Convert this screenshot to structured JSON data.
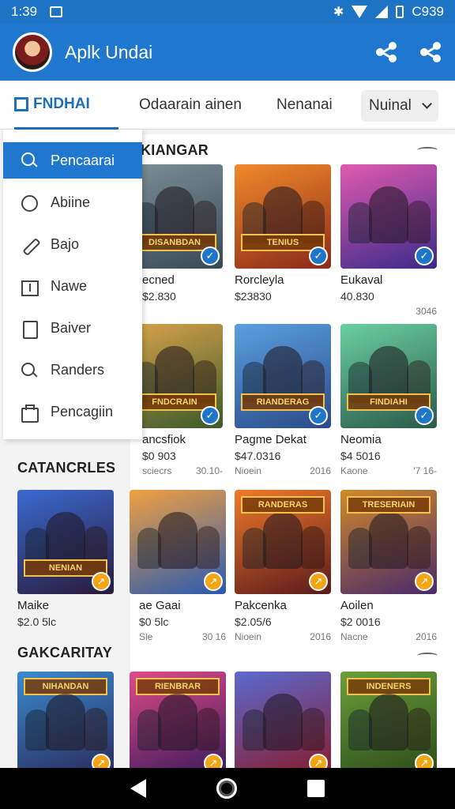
{
  "status_bar": {
    "time": "1:39",
    "battery": "C939"
  },
  "app_bar": {
    "title": "Aplk Undai",
    "share_icon": "share-icon"
  },
  "tabs": [
    {
      "label": "FNDHAI",
      "active": true
    },
    {
      "label": "Odaarain ainen",
      "active": false
    },
    {
      "label": "Nenanai",
      "active": false
    },
    {
      "label": "Nuinal",
      "dropdown": true
    }
  ],
  "side_menu": {
    "items": [
      {
        "label": "Pencaarai",
        "icon": "search-icon",
        "active": true
      },
      {
        "label": "Abiine",
        "icon": "chat-icon"
      },
      {
        "label": "Bajo",
        "icon": "pen-icon"
      },
      {
        "label": "Nawe",
        "icon": "list-icon"
      },
      {
        "label": "Baiver",
        "icon": "file-icon"
      },
      {
        "label": "Randers",
        "icon": "search-icon"
      },
      {
        "label": "Pencagiin",
        "icon": "bag-icon"
      }
    ]
  },
  "sections": {
    "top": "KIANGAR",
    "categories": "CATANCRLES",
    "gakcaritay": "GAKCARITAY"
  },
  "row1": [
    {
      "title": "ecned",
      "price": "$2.830",
      "meta_left": "",
      "meta_right": "",
      "logo": "DISANBDAN",
      "color": "#4a5a5a"
    },
    {
      "title": "Rorcleyla",
      "price": "$23830",
      "meta_left": "",
      "meta_right": "",
      "logo": "TENIUS",
      "color": "#c2562a"
    },
    {
      "title": "Eukaval",
      "price": "40.830",
      "meta_left": "",
      "meta_right": "3046",
      "logo": "",
      "color": "#6a3a9a"
    }
  ],
  "row2": [
    {
      "title": "ancsfiok",
      "price": "$0 903",
      "meta_left": "sciecrs",
      "meta_right": "30.10-",
      "logo": "FNDCRAIN",
      "color": "#4a6a2a"
    },
    {
      "title": "Pagme Dekat",
      "price": "$47.0316",
      "meta_left": "Nioein",
      "meta_right": "2016",
      "logo": "RIANDERAG",
      "color": "#3a6ab0"
    },
    {
      "title": "Neomia",
      "price": "$4 5016",
      "meta_left": "Kaone",
      "meta_right": "'7 16-",
      "logo": "FINDIAHI",
      "color": "#2a7a5a"
    }
  ],
  "row3": [
    {
      "title": "Maike",
      "price": "$2.0 5lc",
      "meta_left": "",
      "meta_right": "",
      "logo": "NENIAN",
      "color": "#3a2a6a",
      "badge": "orange"
    },
    {
      "title": "ae Gaai",
      "price": "$0 5lc",
      "meta_left": "Sle",
      "meta_right": "30 16",
      "logo": "",
      "color": "#2a7ad0",
      "badge": "orange"
    },
    {
      "title": "Pakcenka",
      "price": "$2.05/6",
      "meta_left": "Nioein",
      "meta_right": "2016",
      "logo": "RANDERAS",
      "color": "#c0401a",
      "badge": "orange"
    },
    {
      "title": "Aoilen",
      "price": "$2 0016",
      "meta_left": "Nacne",
      "meta_right": "2016",
      "logo": "TRESERIAIN",
      "color": "#6a3a8a",
      "badge": "orange"
    }
  ],
  "row4": [
    {
      "logo": "NIHANDAN",
      "color": "#2a4a8a",
      "badge": "orange"
    },
    {
      "logo": "RIENBRAR",
      "color": "#a02a5a",
      "badge": "orange"
    },
    {
      "logo": "",
      "color": "#4a2a7a",
      "badge": "orange"
    },
    {
      "logo": "INDENERS",
      "color": "#3a6a2a",
      "badge": "orange"
    }
  ],
  "nav_bar": {
    "back": "back-icon",
    "home": "home-icon",
    "recent": "recent-apps-icon"
  }
}
